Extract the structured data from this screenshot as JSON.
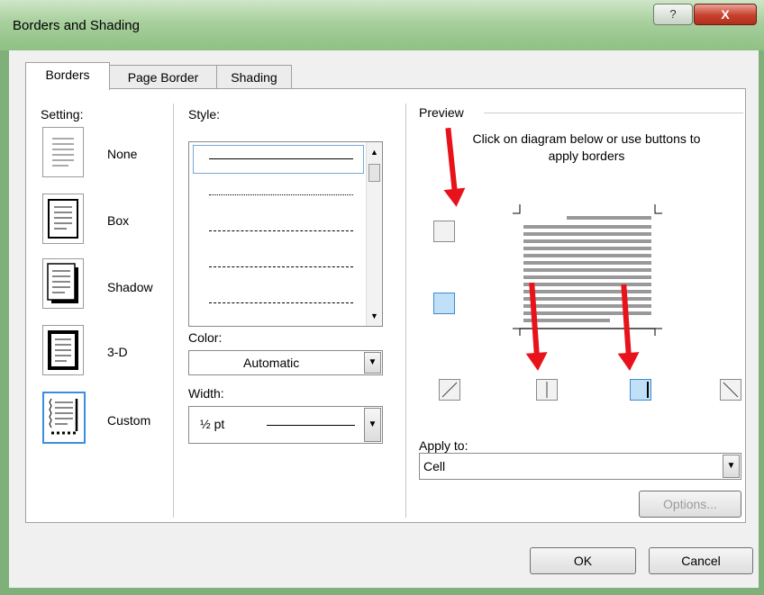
{
  "window": {
    "title": "Borders and Shading",
    "help": "?",
    "close": "X"
  },
  "tabs": [
    {
      "label": "Borders",
      "key": "B"
    },
    {
      "label": "Page Border",
      "key": "P"
    },
    {
      "label": "Shading",
      "key": "S"
    }
  ],
  "setting": {
    "heading": "Setting:",
    "items": [
      {
        "label": "None"
      },
      {
        "label": "Box"
      },
      {
        "label": "Shadow"
      },
      {
        "label": "3-D"
      },
      {
        "label": "Custom"
      }
    ],
    "selected": "Custom"
  },
  "style": {
    "heading": "Style:"
  },
  "color": {
    "label": "Color:",
    "value": "Automatic"
  },
  "width": {
    "label": "Width:",
    "value": "½ pt"
  },
  "preview": {
    "heading": "Preview",
    "instructions": "Click on diagram below or use buttons to apply borders"
  },
  "apply_to": {
    "label": "Apply to:",
    "value": "Cell"
  },
  "buttons": {
    "options": "Options...",
    "ok": "OK",
    "cancel": "Cancel"
  },
  "colors": {
    "annotation_arrow": "#e8121a",
    "selected_border": "#3c8de0",
    "titlebar": "#a7cf9c"
  }
}
